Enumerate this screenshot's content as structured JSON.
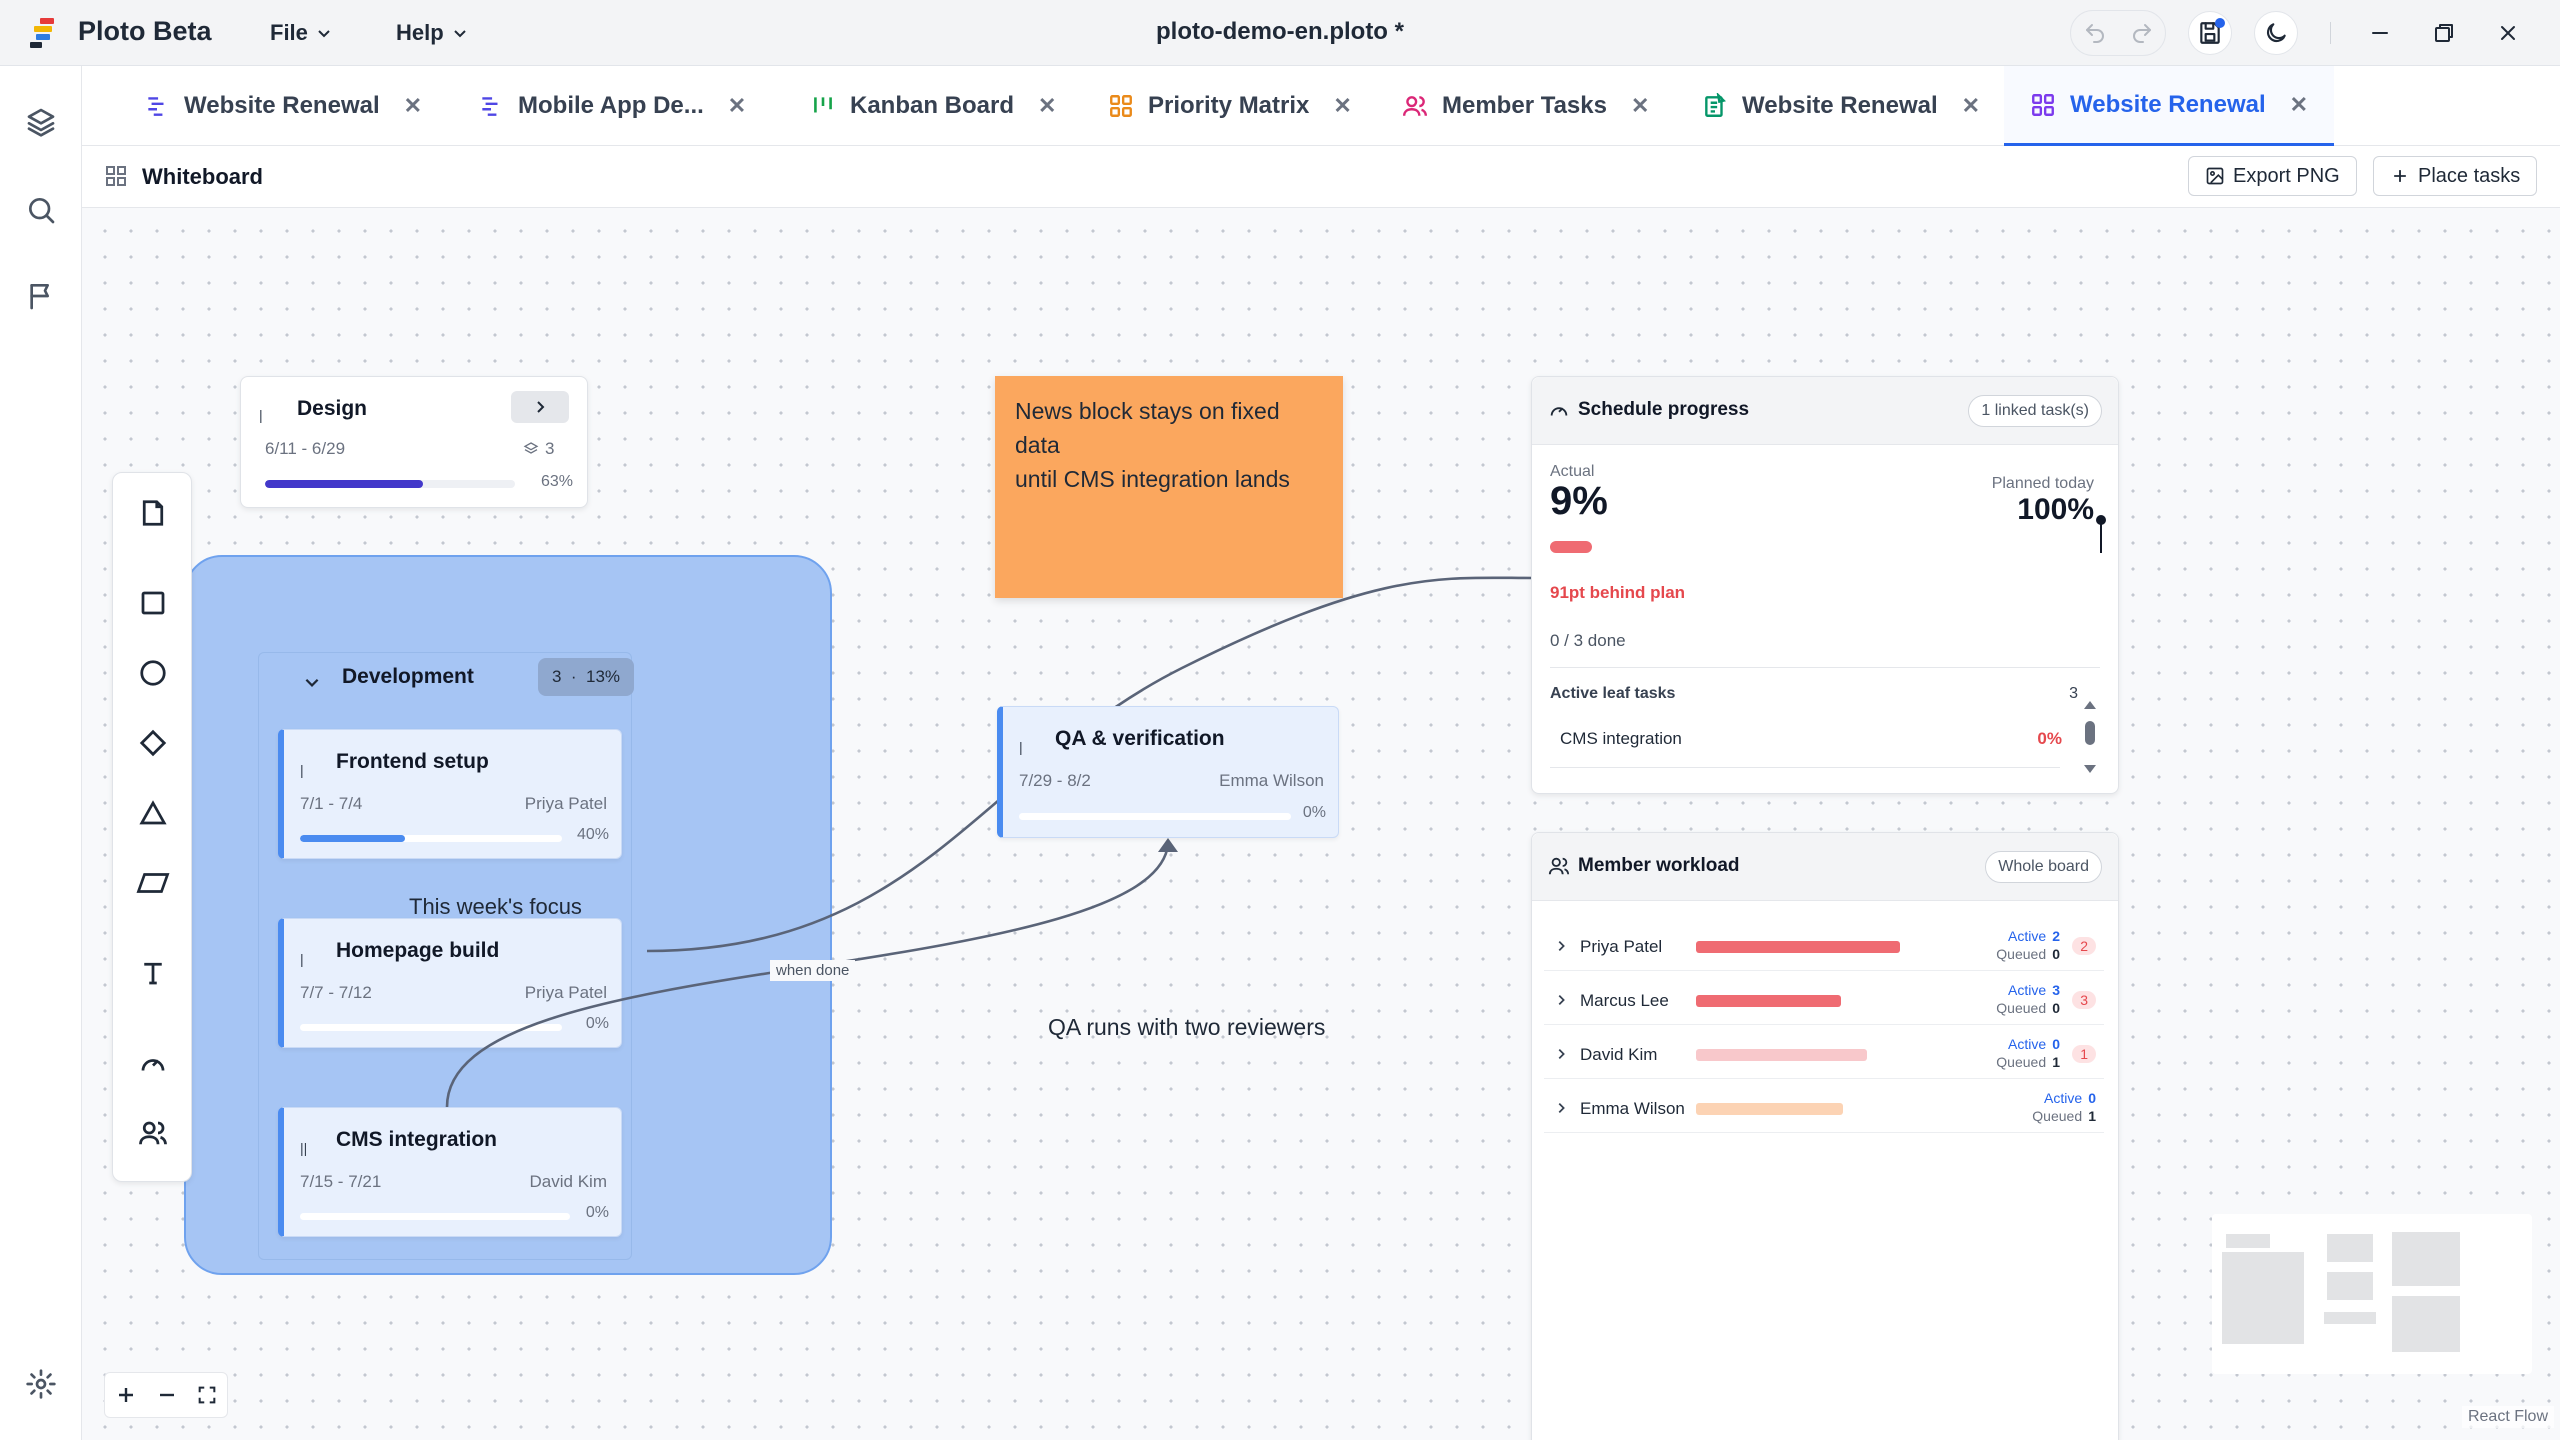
{
  "app": {
    "name": "Ploto Beta",
    "file_title": "ploto-demo-en.ploto *"
  },
  "menu": {
    "file": "File",
    "help": "Help"
  },
  "tabs": [
    {
      "label": "Website Renewal",
      "icon": "gantt-icon",
      "color": "#4f46e5"
    },
    {
      "label": "Mobile App De...",
      "icon": "gantt-icon",
      "color": "#4f46e5"
    },
    {
      "label": "Kanban Board",
      "icon": "kanban-icon",
      "color": "#16a34a"
    },
    {
      "label": "Priority Matrix",
      "icon": "matrix-icon",
      "color": "#ea8a1a"
    },
    {
      "label": "Member Tasks",
      "icon": "users-icon",
      "color": "#db2777"
    },
    {
      "label": "Website Renewal",
      "icon": "sheet-icon",
      "color": "#059669"
    },
    {
      "label": "Website Renewal",
      "icon": "whiteboard-icon",
      "color": "#7c3aed",
      "active": true
    }
  ],
  "board": {
    "title": "Whiteboard",
    "export_label": "Export PNG",
    "place_label": "Place tasks"
  },
  "design": {
    "title": "Design",
    "dates": "6/11 - 6/29",
    "count": "3",
    "progress": 0.63,
    "progress_label": "63%"
  },
  "group": {
    "title": "Development",
    "badge": "3  ·  13%",
    "label": "This week's focus",
    "tasks": [
      {
        "title": "Frontend setup",
        "dates": "7/1 - 7/4",
        "owner": "Priya Patel",
        "progress": 0.4,
        "progress_label": "40%"
      },
      {
        "title": "Homepage build",
        "dates": "7/7 - 7/12",
        "owner": "Priya Patel",
        "progress": 0.0,
        "progress_label": "0%"
      },
      {
        "title": "CMS integration",
        "dates": "7/15 - 7/21",
        "owner": "David Kim",
        "progress": 0.0,
        "progress_label": "0%"
      }
    ]
  },
  "sticky": {
    "lines": [
      "News block stays on fixed data",
      "until CMS integration lands"
    ],
    "color": "#fba75e"
  },
  "qa": {
    "title": "QA & verification",
    "dates": "7/29 - 8/2",
    "owner": "Emma Wilson",
    "progress": 0.0,
    "progress_label": "0%"
  },
  "edge_label": "when done",
  "note": "QA runs with two reviewers",
  "schedule": {
    "title": "Schedule progress",
    "linked": "1 linked task(s)",
    "actual_label": "Actual",
    "actual": "9%",
    "actual_fraction": 0.09,
    "planned_label": "Planned today",
    "planned": "100%",
    "behind": "91pt behind plan",
    "done": "0 / 3 done",
    "leaf_label": "Active leaf tasks",
    "leaf_count": "3",
    "leaf_task": "CMS integration",
    "leaf_pct": "0%"
  },
  "workload": {
    "title": "Member workload",
    "scope": "Whole board",
    "active_label": "Active",
    "queued_label": "Queued",
    "members": [
      {
        "name": "Priya Patel",
        "active": "2",
        "queued": "0",
        "badge": "2",
        "load": 1.0,
        "color": "#ef6b72"
      },
      {
        "name": "Marcus Lee",
        "active": "3",
        "queued": "0",
        "badge": "3",
        "load": 0.71,
        "color": "#ef6b72"
      },
      {
        "name": "David Kim",
        "active": "0",
        "queued": "1",
        "badge": "1",
        "load": 0.84,
        "color": "#f8c8cb"
      },
      {
        "name": "Emma Wilson",
        "active": "0",
        "queued": "1",
        "badge": "",
        "load": 0.72,
        "color": "#fcd3b4"
      }
    ]
  },
  "attribution": "React Flow",
  "colors": {
    "accent": "#2563eb",
    "danger": "#e5484d",
    "group_fill": "#a6c5f4"
  }
}
